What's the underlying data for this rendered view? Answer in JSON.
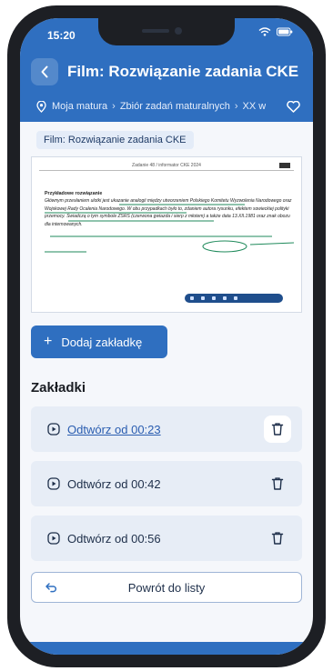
{
  "status": {
    "time": "15:20"
  },
  "header": {
    "title": "Film: Rozwiązanie zadania CKE",
    "breadcrumb": [
      "Moja matura",
      "Zbiór zadań maturalnych",
      "XX w"
    ]
  },
  "film_chip": "Film: Rozwiązanie zadania CKE",
  "video": {
    "header_text": "Zadanie 48 / informator CKE 2024",
    "doc_title": "Przykładowe rozwiązanie",
    "doc_text": "Głównym przesłaniem ulotki jest ukazanie analogii między utworzeniem Polskiego Komitetu Wyzwolenia Narodowego oraz Wojskowej Rady Ocalenia Narodowego. W obu przypadkach było to, zdaniem autora rysunku, efektem sowieckiej polityki przemocy. Świadczą o tym symbole ZSRS (czerwona gwiazda i sierp z młotem) a także data 13.XII.1981 oraz znak obozu dla internowanych."
  },
  "add_bookmark_label": "Dodaj zakładkę",
  "bookmarks_title": "Zakładki",
  "bookmarks": [
    {
      "label": "Odtwórz od 00:23"
    },
    {
      "label": "Odtwórz od 00:42"
    },
    {
      "label": "Odtwórz od 00:56"
    }
  ],
  "return_label": "Powrót do listy",
  "colors": {
    "brand": "#2f6fc0",
    "bookmark_bg": "#e7edf6",
    "link": "#2a5db0"
  }
}
